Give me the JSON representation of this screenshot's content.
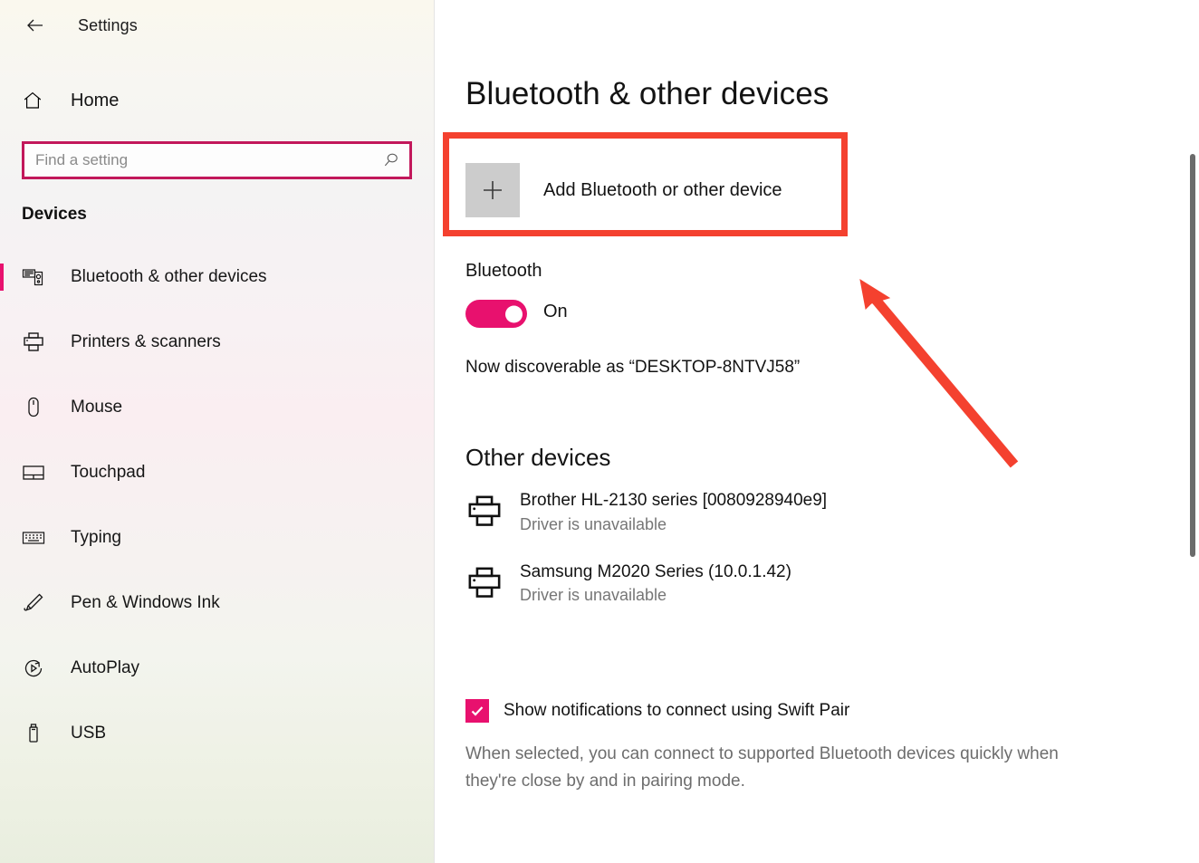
{
  "window": {
    "app_title": "Settings",
    "back_icon": "back-arrow-icon",
    "controls": {
      "minimize": "minimize-icon",
      "maximize": "maximize-icon",
      "close": "close-icon"
    }
  },
  "sidebar": {
    "home_label": "Home",
    "home_icon": "home-icon",
    "search": {
      "placeholder": "Find a setting",
      "value": "",
      "icon": "search-icon"
    },
    "category_heading": "Devices",
    "items": [
      {
        "label": "Bluetooth & other devices",
        "icon": "bluetooth-devices-icon",
        "selected": true
      },
      {
        "label": "Printers & scanners",
        "icon": "printer-icon",
        "selected": false
      },
      {
        "label": "Mouse",
        "icon": "mouse-icon",
        "selected": false
      },
      {
        "label": "Touchpad",
        "icon": "touchpad-icon",
        "selected": false
      },
      {
        "label": "Typing",
        "icon": "keyboard-icon",
        "selected": false
      },
      {
        "label": "Pen & Windows Ink",
        "icon": "pen-icon",
        "selected": false
      },
      {
        "label": "AutoPlay",
        "icon": "autoplay-icon",
        "selected": false
      },
      {
        "label": "USB",
        "icon": "usb-icon",
        "selected": false
      }
    ]
  },
  "main": {
    "page_title": "Bluetooth & other devices",
    "add_device": {
      "label": "Add Bluetooth or other device",
      "icon": "plus-icon"
    },
    "bluetooth": {
      "label": "Bluetooth",
      "toggle_state": "On",
      "discoverable_text": "Now discoverable as “DESKTOP-8NTVJ58”"
    },
    "other_devices": {
      "heading": "Other devices",
      "devices": [
        {
          "name": "Brother HL-2130 series [0080928940e9]",
          "status": "Driver is unavailable",
          "icon": "printer-icon"
        },
        {
          "name": "Samsung M2020 Series (10.0.1.42)",
          "status": "Driver is unavailable",
          "icon": "printer-icon"
        }
      ]
    },
    "swift_pair": {
      "label": "Show notifications to connect using Swift Pair",
      "checked": true,
      "description": "When selected, you can connect to supported Bluetooth devices quickly when they're close by and in pairing mode."
    }
  },
  "annotations": {
    "highlight_rect_color": "#f4412f",
    "arrow_color": "#f4412f"
  },
  "colors": {
    "accent_pink": "#e8116e",
    "search_border": "#c2185b",
    "annotation_red": "#f4412f",
    "plus_tile_gray": "#cccccc",
    "muted_text": "#767676"
  }
}
